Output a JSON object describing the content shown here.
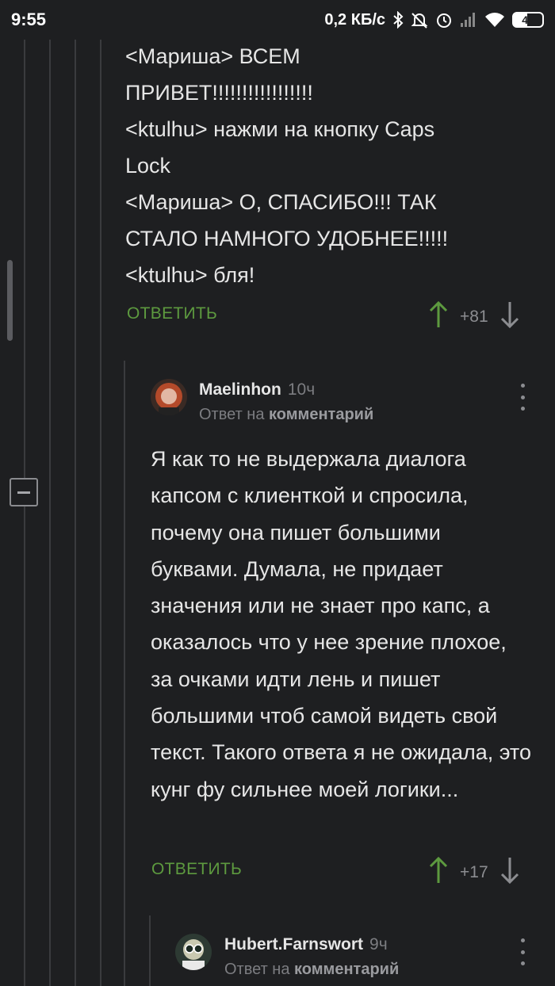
{
  "status": {
    "time": "9:55",
    "speed": "0,2 КБ/с",
    "battery": "47"
  },
  "icons": [
    "bluetooth-icon",
    "dnd-icon",
    "alarm-icon",
    "signal-icon",
    "wifi-icon",
    "battery-icon",
    "upvote-icon",
    "downvote-icon",
    "more-icon",
    "collapse-icon"
  ],
  "accent": "#5d9a3f",
  "quoted_comment": {
    "text": "<Мариша> ВСЕМ\nПРИВЕТ!!!!!!!!!!!!!!!!!\n<ktulhu> нажми на кнопку Caps\nLock\n<Мариша> О, СПАСИБО!!! ТАК\nСТАЛО НАМНОГО УДОБНЕЕ!!!!!\n<ktulhu> бля!",
    "reply_label": "ОТВЕТИТЬ",
    "score": "+81"
  },
  "comment1": {
    "author": "Maelinhon",
    "time": "10ч",
    "reply_prefix": "Ответ на",
    "reply_target": "комментарий",
    "text": "Я как то не выдержала диалога капсом с клиенткой и спросила, почему она пишет большими буквами. Думала, не придает значения или не знает про капс, а оказалось что у нее зрение плохое, за очками идти лень и пишет большими чтоб самой видеть свой текст. Такого ответа я не ожидала, это кунг фу сильнее моей логики...",
    "reply_label": "ОТВЕТИТЬ",
    "score": "+17"
  },
  "comment2": {
    "author": "Hubert.Farnswort",
    "time": "9ч",
    "reply_prefix": "Ответ на",
    "reply_target": "комментарий"
  }
}
